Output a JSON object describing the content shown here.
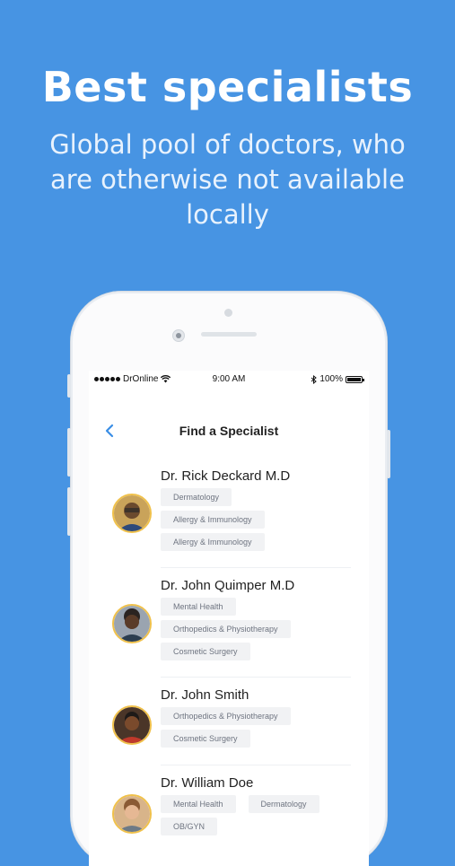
{
  "hero": {
    "title": "Best specialists",
    "subtitle": "Global pool of doctors, who are otherwise not available locally"
  },
  "status_bar": {
    "carrier": "DrOnline",
    "time": "9:00 AM",
    "battery": "100%"
  },
  "nav": {
    "back_icon": "chevron-left-icon",
    "title": "Find a Specialist"
  },
  "colors": {
    "background": "#4794e3",
    "accent": "#3a8ee6",
    "avatar_ring": "#f0c14b"
  },
  "doctors": [
    {
      "name": "Dr. Rick Deckard M.D",
      "tags": [
        "Dermatology",
        "Allergy & Immunology",
        "Allergy & Immunology"
      ]
    },
    {
      "name": "Dr. John Quimper M.D",
      "tags": [
        "Mental Health",
        "Orthopedics & Physiotherapy",
        "Cosmetic Surgery"
      ]
    },
    {
      "name": "Dr. John Smith",
      "tags": [
        "Orthopedics & Physiotherapy",
        "Cosmetic Surgery"
      ]
    },
    {
      "name": "Dr. William Doe",
      "tags": [
        "Mental Health",
        "Dermatology",
        "OB/GYN"
      ]
    }
  ]
}
